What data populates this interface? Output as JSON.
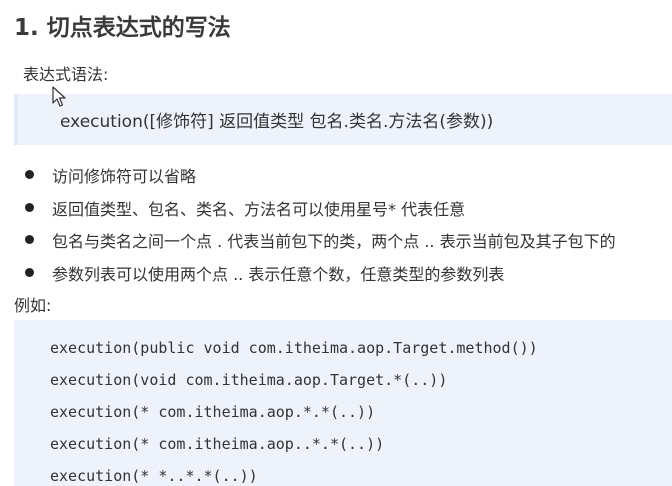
{
  "heading": "1. 切点表达式的写法",
  "syntax_label": "表达式语法:",
  "syntax": "execution([修饰符] 返回值类型 包名.类名.方法名(参数))",
  "bullets": [
    "访问修饰符可以省略",
    "返回值类型、包名、类名、方法名可以使用星号* 代表任意",
    "包名与类名之间一个点 . 代表当前包下的类，两个点 .. 表示当前包及其子包下的",
    "参数列表可以使用两个点 .. 表示任意个数，任意类型的参数列表"
  ],
  "example_label": "例如:",
  "examples": [
    "execution(public void com.itheima.aop.Target.method())",
    "execution(void com.itheima.aop.Target.*(..))",
    "execution(* com.itheima.aop.*.*(..))",
    "execution(* com.itheima.aop..*.*(..))",
    "execution(* *..*.*(..))"
  ],
  "icons": {
    "cursor": "mouse-pointer-icon"
  }
}
